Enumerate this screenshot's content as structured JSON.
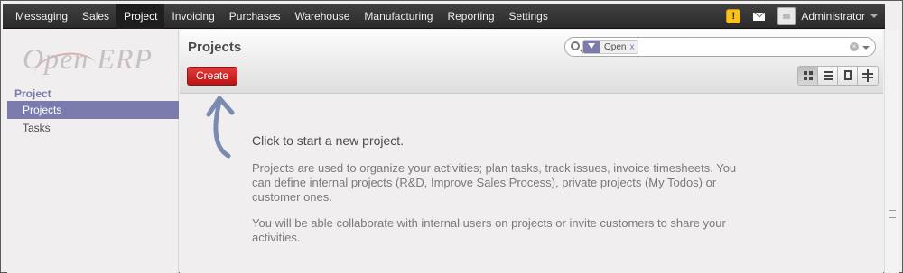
{
  "menu": {
    "items": [
      {
        "label": "Messaging"
      },
      {
        "label": "Sales"
      },
      {
        "label": "Project",
        "active": true
      },
      {
        "label": "Invoicing"
      },
      {
        "label": "Purchases"
      },
      {
        "label": "Warehouse"
      },
      {
        "label": "Manufacturing"
      },
      {
        "label": "Reporting"
      },
      {
        "label": "Settings"
      }
    ]
  },
  "topbar": {
    "warning_icon_text": "!",
    "user_name": "Administrator",
    "icons": [
      "warning-icon",
      "mail-icon",
      "avatar",
      "chevron-down-icon"
    ]
  },
  "sidebar": {
    "logo_open": "Open",
    "logo_erp": "ERP",
    "section_title": "Project",
    "items": [
      {
        "label": "Projects",
        "selected": true
      },
      {
        "label": "Tasks"
      }
    ]
  },
  "header": {
    "title": "Projects",
    "create_label": "Create"
  },
  "search": {
    "facet_label": "Open",
    "facet_remove": "x",
    "icons": [
      "search-icon",
      "filter-icon",
      "clear-icon",
      "dropdown-icon"
    ]
  },
  "view_switcher": {
    "views": [
      "kanban",
      "list",
      "form",
      "gantt"
    ],
    "active": "kanban"
  },
  "empty_state": {
    "title": "Click to start a new project.",
    "paragraph1": "Projects are used to organize your activities; plan tasks, track issues, invoice timesheets. You can define internal projects (R&D, Improve Sales Process), private projects (My Todos) or customer ones.",
    "paragraph2": "You will be able collaborate with internal users on projects or invite customers to share your activities."
  },
  "colors": {
    "brand_purple": "#7c7bad",
    "create_red": "#c41d1d",
    "topbar_dark": "#2f2f2f"
  }
}
